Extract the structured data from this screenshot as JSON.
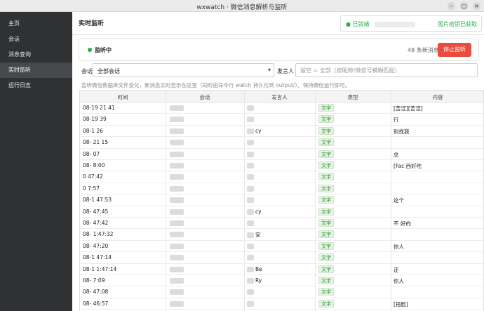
{
  "window": {
    "title": "wxwatch · 微信消息解析与监听",
    "controls": [
      "–",
      "□",
      "×"
    ]
  },
  "sidebar": {
    "items": [
      {
        "label": "主页",
        "active": false
      },
      {
        "label": "会话",
        "active": false
      },
      {
        "label": "消息查询",
        "active": false
      },
      {
        "label": "实时监听",
        "active": true
      },
      {
        "label": "运行日志",
        "active": false
      }
    ]
  },
  "header": {
    "title": "实时监听",
    "status_ready": "● 已就绪",
    "status_key": "图片密钥已获取"
  },
  "monitor": {
    "status_label": "监听中",
    "new_count": "48 条新消息",
    "stop_label": "停止监听"
  },
  "filter": {
    "session_label": "会话",
    "session_value": "全部会话",
    "sender_label": "发言人",
    "sender_placeholder": "留空 = 全部（按昵称/微信号模糊匹配）"
  },
  "hint": "监听微信数据库文件变化，新消息实时显示在这里（同时由命令行 watch 持久化到 output/）。保持微信运行即可。",
  "table": {
    "columns": [
      "时间",
      "会话",
      "发言人",
      "类型",
      "内容"
    ],
    "rows": [
      {
        "time": "08-19 21   41",
        "sender": "",
        "type": "文字",
        "content": "[苦涩][苦涩]"
      },
      {
        "time": "08-19     39",
        "sender": "",
        "type": "文字",
        "content": "                 行"
      },
      {
        "time": "08-1       26",
        "sender": "cy",
        "type": "文字",
        "content": "别找我"
      },
      {
        "time": "08-     21   15",
        "sender": "",
        "type": "文字",
        "content": ""
      },
      {
        "time": "08-          07",
        "sender": "",
        "type": "文字",
        "content": "           总"
      },
      {
        "time": "08-         8:00",
        "sender": "",
        "type": "文字",
        "content": "[Fac                  西好吃"
      },
      {
        "time": "0        47:42",
        "sender": "",
        "type": "文字",
        "content": ""
      },
      {
        "time": "0          7:57",
        "sender": "",
        "type": "文字",
        "content": ""
      },
      {
        "time": "08-1      47:53",
        "sender": "",
        "type": "文字",
        "content": "这个               "
      },
      {
        "time": "08-       47:45",
        "sender": "cy",
        "type": "文字",
        "content": ""
      },
      {
        "time": "08-       47:42",
        "sender": "",
        "type": "文字",
        "content": "不        好的"
      },
      {
        "time": "08-       1:47:32",
        "sender": "安",
        "type": "文字",
        "content": ""
      },
      {
        "time": "08-       47:20",
        "sender": "",
        "type": "文字",
        "content": "你人"
      },
      {
        "time": "08-1      47:14",
        "sender": "",
        "type": "文字",
        "content": ""
      },
      {
        "time": "08-1      1:47:14",
        "sender": "Be",
        "type": "文字",
        "content": "还"
      },
      {
        "time": "08-         7:09",
        "sender": "Ry",
        "type": "文字",
        "content": "你人"
      },
      {
        "time": "08-       47:08",
        "sender": "",
        "type": "文字",
        "content": ""
      },
      {
        "time": "08-        46:57",
        "sender": "",
        "type": "文字",
        "content": "[捂脸]"
      }
    ]
  },
  "colors": {
    "sidebar_bg": "#2f3133",
    "sidebar_active": "#46494c",
    "accent_green": "#2eaa4a",
    "stop_red": "#e74c3c"
  }
}
